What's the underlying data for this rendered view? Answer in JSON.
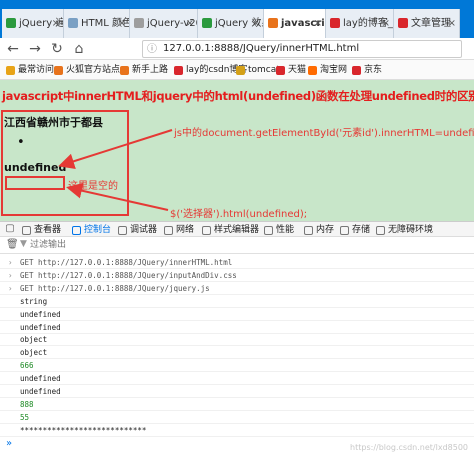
{
  "tabs": [
    {
      "title": "jQuery 遍历",
      "favicon_color": "#2b9a3e"
    },
    {
      "title": "HTML 颜色名",
      "favicon_color": "#7aa0c4"
    },
    {
      "title": "jQuery-v2015V",
      "favicon_color": "#9e9e9e"
    },
    {
      "title": "jQuery 效果",
      "favicon_color": "#2b9a3e"
    },
    {
      "title": "javascript",
      "favicon_color": "#e8731c",
      "active": true
    },
    {
      "title": "lay的博客_lay",
      "favicon_color": "#d9262c"
    },
    {
      "title": "文章管理",
      "favicon_color": "#d9262c"
    }
  ],
  "nav": {
    "back_icon": "back-arrow",
    "forward_icon": "forward-arrow",
    "refresh_icon": "refresh",
    "home_icon": "home",
    "url": "127.0.0.1:8888/JQuery/innerHTML.html"
  },
  "bookmarks": [
    {
      "label": "最常访问",
      "color": "#e8a317"
    },
    {
      "label": "火狐官方站点",
      "color": "#e8731c"
    },
    {
      "label": "新手上路",
      "color": "#e8731c"
    },
    {
      "label": "lay的csdn博客",
      "color": "#d9262c"
    },
    {
      "label": "tomcat",
      "color": "#d4a017"
    },
    {
      "label": "天猫",
      "color": "#d9262c"
    },
    {
      "label": "淘宝网",
      "color": "#ff6a00"
    },
    {
      "label": "京东",
      "color": "#d9262c"
    }
  ],
  "page": {
    "heading": "javascript中innerHTML和jquery中的html(undefined)函数在处理undefined时的区别",
    "city": "江西省赣州市于都县",
    "bullet": "•",
    "undefined_text": "undefined",
    "note_empty": "这里是空的",
    "note_innerhtml": "js中的document.getElementById('元素id').innerHTML=undefined;",
    "note_jquery": "$('选择器').html(undefined);",
    "accent_color": "#e53935",
    "background_color": "#c8e6c9"
  },
  "devtools": {
    "tools": [
      {
        "label": "查看器",
        "active": false
      },
      {
        "label": "控制台",
        "active": true
      },
      {
        "label": "调试器",
        "active": false
      },
      {
        "label": "网络",
        "active": false
      },
      {
        "label": "样式编辑器",
        "active": false
      },
      {
        "label": "性能",
        "active": false
      },
      {
        "label": "内存",
        "active": false
      },
      {
        "label": "存储",
        "active": false
      },
      {
        "label": "无障碍环境",
        "active": false
      }
    ],
    "filter_placeholder": "过滤输出"
  },
  "console": [
    {
      "type": "net",
      "text": "GET http://127.0.0.1:8888/JQuery/innerHTML.html"
    },
    {
      "type": "net",
      "text": "GET http://127.0.0.1:8888/JQuery/inputAndDiv.css"
    },
    {
      "type": "net",
      "text": "GET http://127.0.0.1:8888/JQuery/jquery.js"
    },
    {
      "type": "str",
      "text": "string"
    },
    {
      "type": "str",
      "text": "undefined"
    },
    {
      "type": "str",
      "text": "undefined"
    },
    {
      "type": "str",
      "text": "object"
    },
    {
      "type": "str",
      "text": "object"
    },
    {
      "type": "num",
      "text": "666"
    },
    {
      "type": "str",
      "text": "undefined"
    },
    {
      "type": "str",
      "text": "undefined"
    },
    {
      "type": "num",
      "text": "888"
    },
    {
      "type": "num",
      "text": "55"
    },
    {
      "type": "str",
      "text": "****************************"
    }
  ],
  "watermark": "https://blog.csdn.net/lxd8500"
}
